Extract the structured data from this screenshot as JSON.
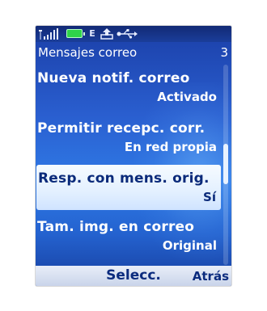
{
  "status_bar": {
    "icons": [
      "signal-strength-icon",
      "battery-icon",
      "edge-icon",
      "upload-icon",
      "usb-icon"
    ],
    "network_label": "E"
  },
  "header": {
    "title": "Mensajes correo",
    "page_number": "3"
  },
  "list": {
    "items": [
      {
        "title": "Nueva notif. correo",
        "value": "Activado",
        "selected": false
      },
      {
        "title": "Permitir recepc. corr.",
        "value": "En red propia",
        "selected": false
      },
      {
        "title": "Resp. con mens. orig.",
        "value": "Sí",
        "selected": true
      },
      {
        "title": "Tam. img. en correo",
        "value": "Original",
        "selected": false
      }
    ]
  },
  "softkeys": {
    "middle": "Selecc.",
    "right": "Atrás"
  },
  "colors": {
    "background_top": "#1b3fa8",
    "background_mid": "#2f7ae6",
    "selection": "#e3f0ff",
    "selected_text": "#0a2a7a",
    "softkey_text": "#0b2b7e",
    "battery": "#2fd34a"
  }
}
